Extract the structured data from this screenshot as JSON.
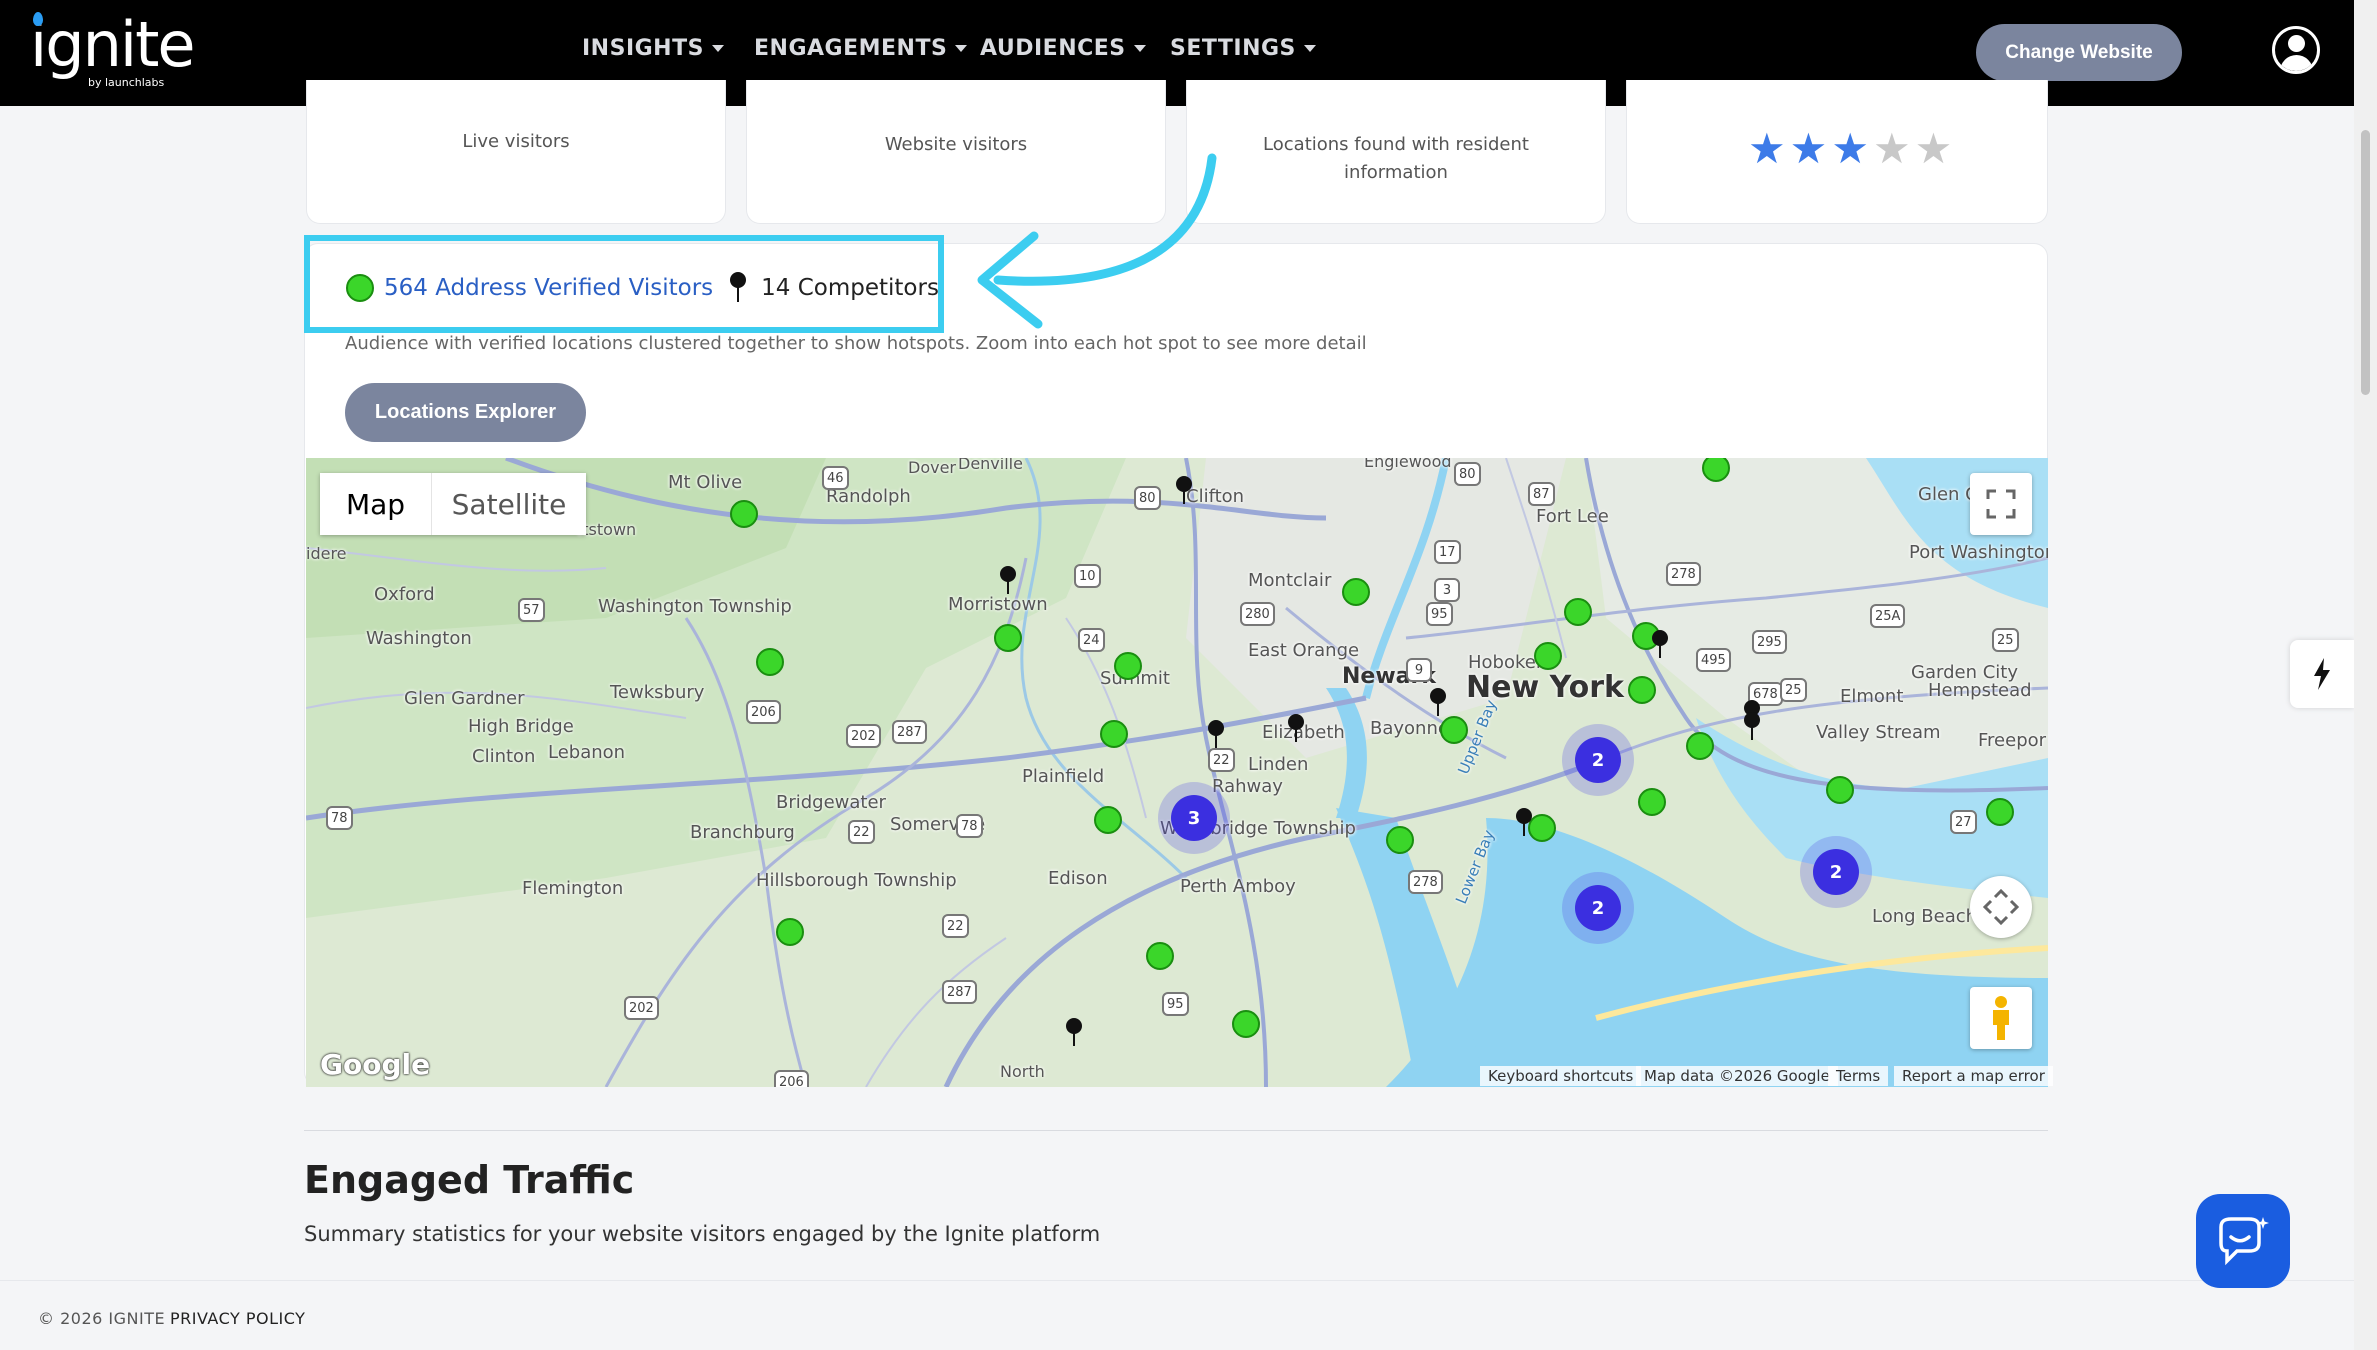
{
  "header": {
    "logo_text": "ignite",
    "logo_sub": "by launchlabs",
    "nav": [
      {
        "label": "INSIGHTS"
      },
      {
        "label": "ENGAGEMENTS"
      },
      {
        "label": "AUDIENCES"
      },
      {
        "label": "SETTINGS"
      }
    ],
    "change_website": "Change Website"
  },
  "stat_cards": [
    {
      "caption": "Live visitors"
    },
    {
      "caption": "Website visitors"
    },
    {
      "caption": "Locations found with resident information"
    },
    {
      "caption": "",
      "rating": 3,
      "rating_max": 5
    }
  ],
  "locations": {
    "verified_label": "564 Address Verified Visitors",
    "competitors_label": "14 Competitors",
    "description": "Audience with verified locations clustered together to show hotspots. Zoom into each hot spot to see more detail",
    "explorer_button": "Locations Explorer"
  },
  "map": {
    "type_map": "Map",
    "type_satellite": "Satellite",
    "google": "Google",
    "attribution": [
      "Keyboard shortcuts",
      "Map data ©2026 Google",
      "Terms",
      "Report a map error"
    ],
    "places": [
      "Dover",
      "Denville",
      "Mt Olive",
      "Randolph",
      "Clifton",
      "Englewood",
      "Glen C",
      "Fort Lee",
      "Port Washington",
      "Montclair",
      "Morristown",
      "Washington Township",
      "Oxford",
      "Washington",
      "East Orange",
      "Newark",
      "Hoboken",
      "New York",
      "Garden City",
      "Hempstead",
      "Elmont",
      "Valley Stream",
      "Freepor",
      "Summit",
      "Tewksbury",
      "Glen Gardner",
      "High Bridge",
      "Clinton",
      "Lebanon",
      "Elizabeth",
      "Bayonne",
      "Linden",
      "Rahway",
      "Plainfield",
      "Bridgewater",
      "Somerville",
      "Branchburg",
      "Woodbridge Township",
      "Perth Amboy",
      "Edison",
      "Flemington",
      "Hillsborough Township",
      "Long Beach",
      "Upper Bay",
      "Lower Bay",
      "North",
      "idere",
      "ttstown"
    ],
    "clusters": [
      {
        "count": "3"
      },
      {
        "count": "2"
      },
      {
        "count": "2"
      },
      {
        "count": "2"
      }
    ],
    "highway_shields": [
      "46",
      "80",
      "80",
      "87",
      "17",
      "3",
      "10",
      "278",
      "57",
      "280",
      "95",
      "24",
      "25A",
      "295",
      "25",
      "495",
      "9",
      "678",
      "25",
      "206",
      "202",
      "287",
      "22",
      "78",
      "78",
      "278",
      "22",
      "22",
      "202",
      "287",
      "95",
      "206",
      "27"
    ]
  },
  "engaged": {
    "title": "Engaged Traffic",
    "description": "Summary statistics for your website visitors engaged by the Ignite platform"
  },
  "footer": {
    "copyright": "© 2026 IGNITE",
    "privacy": "PRIVACY POLICY"
  },
  "colors": {
    "accent": "#3ccdf0",
    "button": "#7b859e",
    "link": "#2a5fc4",
    "verified_marker": "#3bd62a",
    "cluster": "#3b2fe0",
    "chat": "#1a5de0",
    "star_on": "#3d7be8",
    "star_off": "#c8c8c8"
  }
}
